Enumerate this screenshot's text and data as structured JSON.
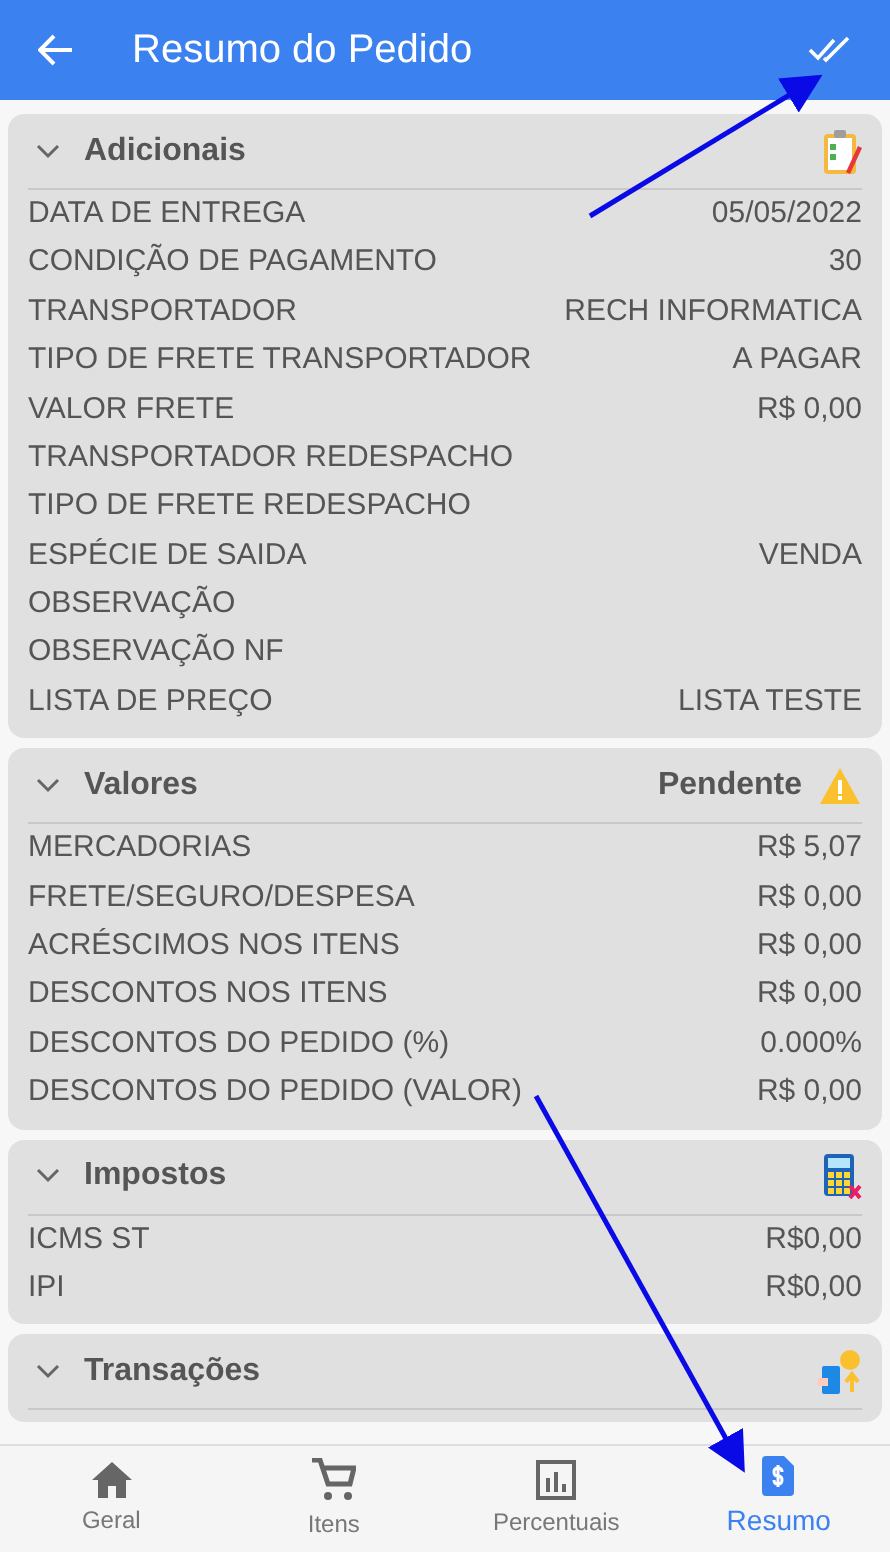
{
  "app_bar": {
    "title": "Resumo do Pedido"
  },
  "sections": [
    {
      "title": "Adicionais",
      "kind": "clipboard",
      "expanded": true,
      "rows": [
        {
          "label": "DATA DE ENTREGA",
          "value": "05/05/2022"
        },
        {
          "label": "CONDIÇÃO DE PAGAMENTO",
          "value": "30"
        },
        {
          "label": "TRANSPORTADOR",
          "value": "RECH INFORMATICA"
        },
        {
          "label": "TIPO DE FRETE TRANSPORTADOR",
          "value": "A PAGAR"
        },
        {
          "label": "VALOR FRETE",
          "value": "R$ 0,00"
        },
        {
          "label": "TRANSPORTADOR REDESPACHO"
        },
        {
          "label": "TIPO DE FRETE REDESPACHO"
        },
        {
          "label": "ESPÉCIE DE SAIDA",
          "value": "VENDA"
        },
        {
          "label": "OBSERVAÇÃO"
        },
        {
          "label": "OBSERVAÇÃO NF"
        },
        {
          "label": "LISTA DE PREÇO",
          "value": "LISTA TESTE"
        }
      ]
    },
    {
      "title": "Valores",
      "kind": "warning",
      "status": "Pendente",
      "expanded": true,
      "rows": [
        {
          "label": "MERCADORIAS",
          "value": "R$ 5,07"
        },
        {
          "label": "FRETE/SEGURO/DESPESA",
          "value": "R$ 0,00"
        },
        {
          "label": "ACRÉSCIMOS NOS ITENS",
          "value": "R$ 0,00"
        },
        {
          "label": "DESCONTOS NOS ITENS",
          "value": "R$ 0,00"
        },
        {
          "label": "DESCONTOS DO PEDIDO (%)",
          "value": "0.000%"
        },
        {
          "label": "DESCONTOS DO PEDIDO (VALOR)",
          "value": "R$ 0,00"
        }
      ]
    },
    {
      "title": "Impostos",
      "kind": "calculator",
      "expanded": true,
      "rows": [
        {
          "label": "ICMS ST",
          "value": "R$0,00"
        },
        {
          "label": "IPI",
          "value": "R$0,00"
        }
      ]
    },
    {
      "title": "Transações",
      "kind": "money",
      "expanded": true
    }
  ],
  "bottom_nav": [
    {
      "label": "Geral",
      "kind": "home",
      "selected": false
    },
    {
      "label": "Itens",
      "kind": "cart",
      "selected": false
    },
    {
      "label": "Percentuais",
      "kind": "chart",
      "selected": false
    },
    {
      "label": "Resumo",
      "kind": "receipt",
      "selected": true
    }
  ]
}
